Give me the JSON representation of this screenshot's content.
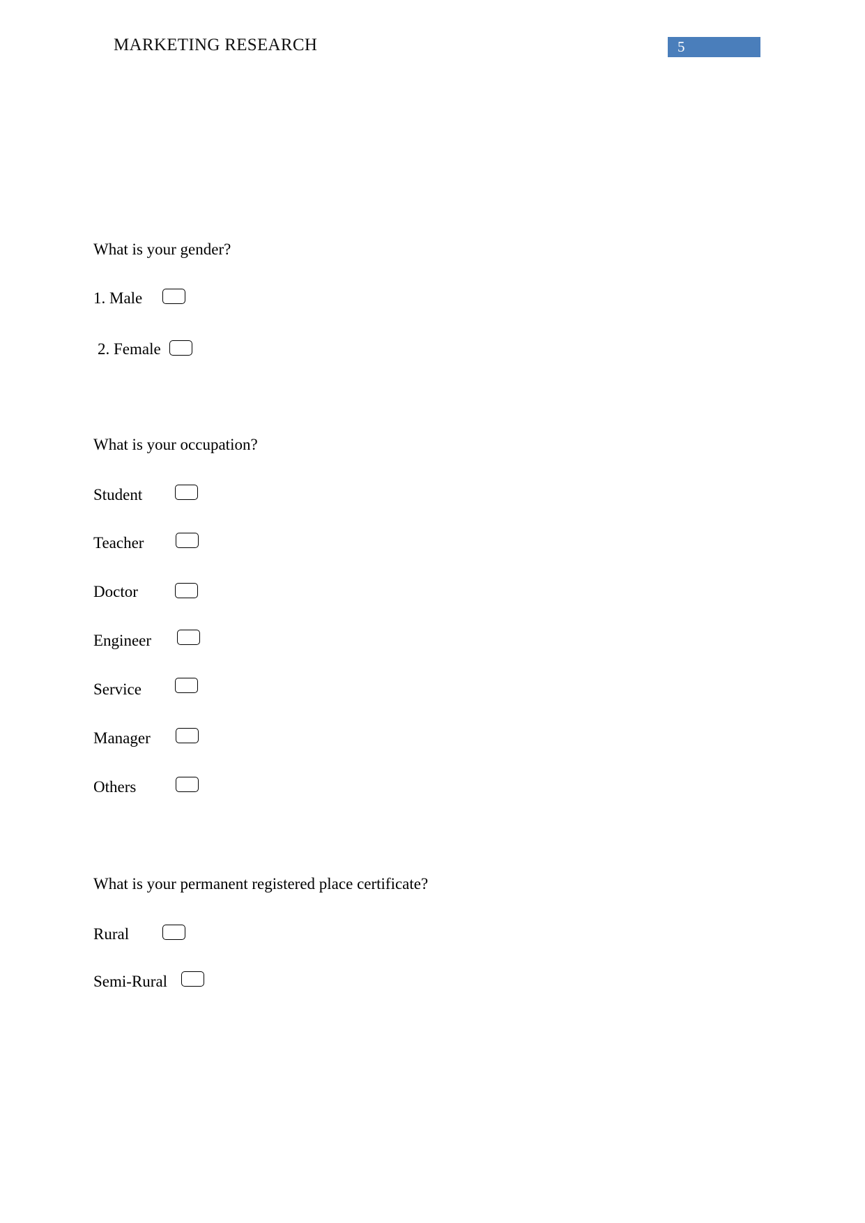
{
  "header": {
    "title": "MARKETING RESEARCH",
    "page_number": "5",
    "page_number_bg": "#4a7ebb",
    "page_number_color": "#ffffff"
  },
  "document": {
    "background": "#ffffff",
    "text_color": "#000000"
  },
  "questions": [
    {
      "id": "gender",
      "text": "What is your gender?",
      "options": [
        {
          "label": "1. Male",
          "checked": false
        },
        {
          "label": "2. Female",
          "checked": false
        }
      ]
    },
    {
      "id": "occupation",
      "text": "What is your occupation?",
      "options": [
        {
          "label": "Student",
          "checked": false
        },
        {
          "label": "Teacher",
          "checked": false
        },
        {
          "label": "Doctor",
          "checked": false
        },
        {
          "label": "Engineer",
          "checked": false
        },
        {
          "label": "Service",
          "checked": false
        },
        {
          "label": "Manager",
          "checked": false
        },
        {
          "label": "Others",
          "checked": false
        }
      ]
    },
    {
      "id": "registered-place",
      "text": "What is your permanent registered place certificate?",
      "options": [
        {
          "label": "Rural",
          "checked": false
        },
        {
          "label": "Semi-Rural",
          "checked": false
        }
      ]
    }
  ]
}
